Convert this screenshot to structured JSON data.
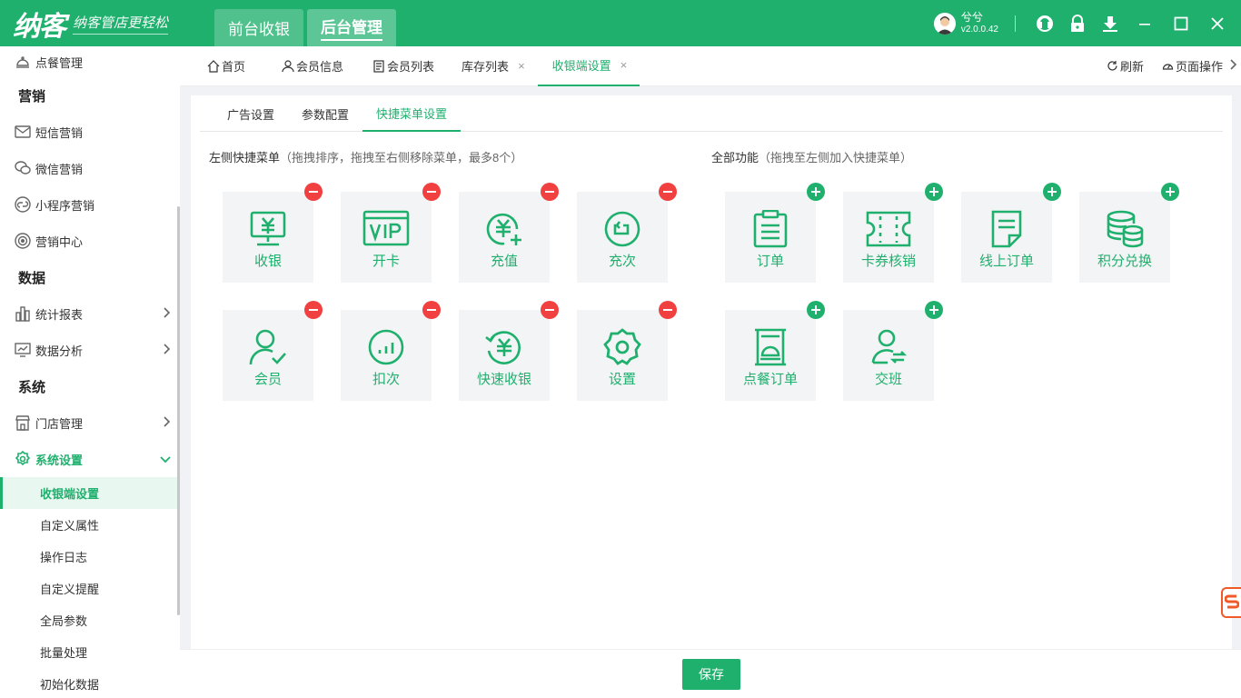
{
  "brand": {
    "logo": "纳客",
    "slogan": "纳客管店更轻松"
  },
  "top_tabs": [
    {
      "label": "前台收银"
    },
    {
      "label": "后台管理"
    }
  ],
  "user": {
    "name": "兮兮",
    "version": "v2.0.0.42"
  },
  "sidebar": {
    "top_item": "点餐管理",
    "groups": {
      "marketing": "营销",
      "data": "数据",
      "system": "系统"
    },
    "marketing_items": [
      "短信营销",
      "微信营销",
      "小程序营销",
      "营销中心"
    ],
    "data_items": [
      "统计报表",
      "数据分析"
    ],
    "system_items": [
      "门店管理",
      "系统设置"
    ],
    "sub_items": [
      "收银端设置",
      "自定义属性",
      "操作日志",
      "自定义提醒",
      "全局参数",
      "批量处理",
      "初始化数据"
    ]
  },
  "page_tabs": [
    {
      "label": "首页"
    },
    {
      "label": "会员信息"
    },
    {
      "label": "会员列表"
    },
    {
      "label": "库存列表",
      "close": "×"
    },
    {
      "label": "收银端设置",
      "close": "×"
    }
  ],
  "tab_actions": {
    "refresh": "刷新",
    "page_ops": "页面操作"
  },
  "sub_tabs": [
    "广告设置",
    "参数配置",
    "快捷菜单设置"
  ],
  "left_section": {
    "title": "左侧快捷菜单",
    "hint": "（拖拽排序，拖拽至右侧移除菜单，最多8个）"
  },
  "right_section": {
    "title": "全部功能",
    "hint": "（拖拽至左侧加入快捷菜单）"
  },
  "left_tiles": [
    {
      "label": "收银",
      "icon": "cashier-icon"
    },
    {
      "label": "开卡",
      "icon": "vip-card-icon"
    },
    {
      "label": "充值",
      "icon": "recharge-icon"
    },
    {
      "label": "充次",
      "icon": "recharge-times-icon"
    },
    {
      "label": "会员",
      "icon": "member-icon"
    },
    {
      "label": "扣次",
      "icon": "deduct-times-icon"
    },
    {
      "label": "快速收银",
      "icon": "quick-cashier-icon"
    },
    {
      "label": "设置",
      "icon": "settings-icon"
    }
  ],
  "right_tiles": [
    {
      "label": "订单",
      "icon": "order-icon"
    },
    {
      "label": "卡券核销",
      "icon": "coupon-icon"
    },
    {
      "label": "线上订单",
      "icon": "online-order-icon"
    },
    {
      "label": "积分兑换",
      "icon": "points-exchange-icon"
    },
    {
      "label": "点餐订单",
      "icon": "dining-order-icon"
    },
    {
      "label": "交班",
      "icon": "shift-handover-icon"
    }
  ],
  "save_label": "保存",
  "colors": {
    "primary": "#1fb06e",
    "danger": "#f04040",
    "tile_bg": "#f3f4f5"
  }
}
